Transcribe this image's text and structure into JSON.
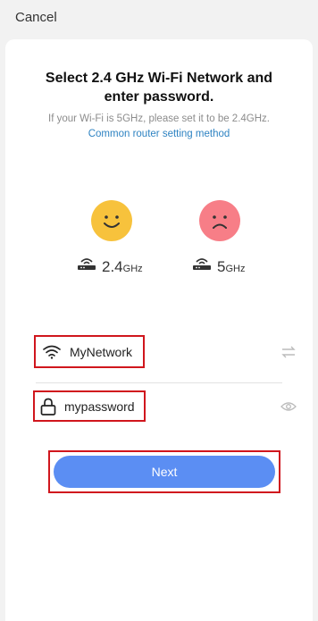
{
  "header": {
    "cancel_label": "Cancel"
  },
  "main": {
    "title_line1": "Select 2.4 GHz Wi-Fi Network and",
    "title_line2": "enter password.",
    "subtitle": "If your Wi-Fi is 5GHz, please set it to be 2.4GHz.",
    "help_link": "Common router setting method"
  },
  "bands": [
    {
      "face": "happy-face-icon",
      "color": "#f7c23c",
      "value": "2.4",
      "unit": "GHz"
    },
    {
      "face": "sad-face-icon",
      "color": "#f77e87",
      "value": "5",
      "unit": "GHz"
    }
  ],
  "form": {
    "network_value": "MyNetwork",
    "password_value": "mypassword"
  },
  "actions": {
    "next_label": "Next"
  },
  "colors": {
    "accent": "#5b8ef3",
    "link": "#2e83c2",
    "highlight": "#d0161d"
  }
}
